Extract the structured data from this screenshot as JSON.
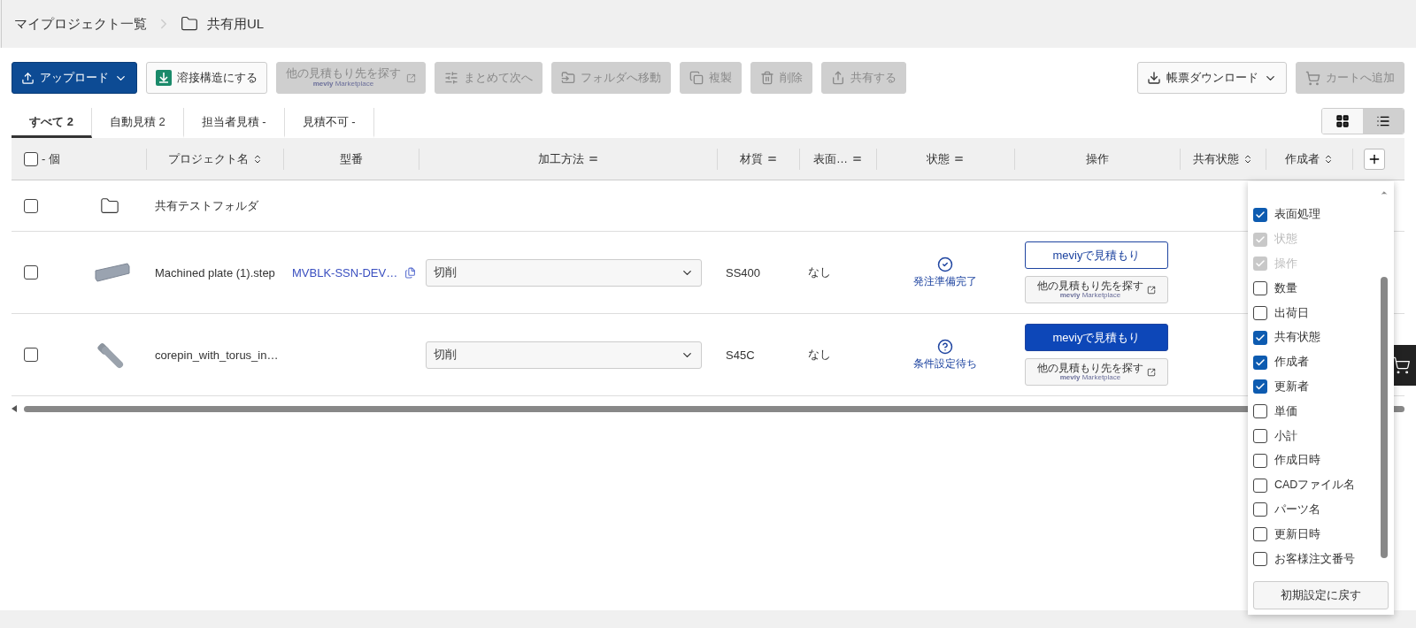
{
  "breadcrumb": [
    {
      "label": "マイプロジェクト一覧",
      "kind": "link"
    },
    {
      "label": "共有用UL",
      "kind": "folder"
    }
  ],
  "toolbar": [
    {
      "label": "アップロード",
      "kind": "upload",
      "disabled": false
    },
    {
      "label": "溶接構造にする",
      "kind": "weld",
      "disabled": false
    },
    {
      "label": "他の見積もり先を探す",
      "sub": "**meviy** Marketplace",
      "kind": "market",
      "disabled": true
    },
    {
      "label": "まとめて次へ",
      "kind": "batch",
      "disabled": true
    },
    {
      "label": "フォルダへ移動",
      "kind": "move",
      "disabled": true
    },
    {
      "label": "複製",
      "kind": "duplicate",
      "disabled": true
    },
    {
      "label": "削除",
      "kind": "delete",
      "disabled": true
    },
    {
      "label": "共有する",
      "kind": "share",
      "disabled": true
    }
  ],
  "toolbar_right": [
    {
      "label": "帳票ダウンロード",
      "kind": "download",
      "disabled": false
    },
    {
      "label": "カートへ追加",
      "kind": "cart",
      "disabled": true
    }
  ],
  "tabs": [
    {
      "label": "すべて",
      "count": "2",
      "selected": true
    },
    {
      "label": "自動見積",
      "count": "2",
      "selected": false
    },
    {
      "label": "担当者見積",
      "count": "-",
      "selected": false
    },
    {
      "label": "見積不可",
      "count": "-",
      "selected": false
    }
  ],
  "view_toggle": [
    {
      "kind": "grid",
      "selected": false
    },
    {
      "kind": "list",
      "selected": true
    }
  ],
  "columns": [
    {
      "label": "- 個",
      "kind": "check",
      "checked": false
    },
    {
      "label": "プロジェクト名",
      "kind": "sort"
    },
    {
      "label": "型番",
      "kind": "plain"
    },
    {
      "label": "加工方法",
      "kind": "filter"
    },
    {
      "label": "材質",
      "kind": "filter"
    },
    {
      "label": "表面…",
      "kind": "filter"
    },
    {
      "label": "状態",
      "kind": "filter"
    },
    {
      "label": "操作",
      "kind": "plain"
    },
    {
      "label": "共有状態",
      "kind": "sort"
    },
    {
      "label": "作成者",
      "kind": "sort"
    }
  ],
  "rows": [
    {
      "kind": "folder",
      "name": "共有テストフォルダ",
      "checked": false
    },
    {
      "kind": "plate",
      "name": "Machined plate (1).step",
      "checked": false,
      "model_number": "MVBLK-SSN-DEV…",
      "process": "切削",
      "material": "SS400",
      "surface": "なし",
      "status": {
        "kind": "done",
        "label": "発注準備完了"
      },
      "quote_button": {
        "label": "meviyで見積もり",
        "filled": false
      },
      "market_button": {
        "label": "他の見積もり先を探す",
        "sub": "**meviy** Marketplace"
      }
    },
    {
      "kind": "pin",
      "name": "corepin_with_torus_in…",
      "checked": false,
      "process": "切削",
      "material": "S45C",
      "surface": "なし",
      "status": {
        "kind": "waiting",
        "label": "条件設定待ち"
      },
      "quote_button": {
        "label": "meviyで見積もり",
        "filled": true
      },
      "market_button": {
        "label": "他の見積もり先を探す",
        "sub": "**meviy** Marketplace"
      }
    }
  ],
  "column_menu": {
    "items": [
      {
        "label": "表面処理",
        "checked": true,
        "disabled": false
      },
      {
        "label": "状態",
        "checked": true,
        "disabled": true
      },
      {
        "label": "操作",
        "checked": true,
        "disabled": true
      },
      {
        "label": "数量",
        "checked": false,
        "disabled": false
      },
      {
        "label": "出荷日",
        "checked": false,
        "disabled": false
      },
      {
        "label": "共有状態",
        "checked": true,
        "disabled": false
      },
      {
        "label": "作成者",
        "checked": true,
        "disabled": false
      },
      {
        "label": "更新者",
        "checked": true,
        "disabled": false
      },
      {
        "label": "単価",
        "checked": false,
        "disabled": false
      },
      {
        "label": "小計",
        "checked": false,
        "disabled": false
      },
      {
        "label": "作成日時",
        "checked": false,
        "disabled": false
      },
      {
        "label": "CADファイル名",
        "checked": false,
        "disabled": false
      },
      {
        "label": "パーツ名",
        "checked": false,
        "disabled": false
      },
      {
        "label": "更新日時",
        "checked": false,
        "disabled": false
      },
      {
        "label": "お客様注文番号",
        "checked": false,
        "disabled": false
      }
    ],
    "reset_label": "初期設定に戻す"
  }
}
